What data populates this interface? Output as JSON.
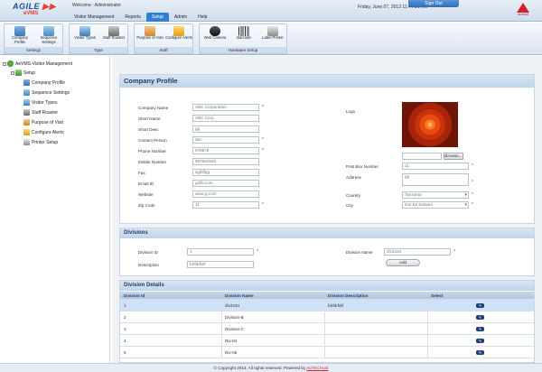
{
  "header": {
    "logo_main": "AGILE",
    "logo_sub": "eVMS",
    "welcome": "Welcome :  Administrator",
    "datetime": "Friday, June 07, 2013   11:44:31 AM",
    "signout": "Sign Out",
    "brand": "ALTECH",
    "tabs": [
      {
        "label": "Visitor Management",
        "active": false
      },
      {
        "label": "Reports",
        "active": false
      },
      {
        "label": "Setup",
        "active": true
      },
      {
        "label": "Admin",
        "active": false
      },
      {
        "label": "Help",
        "active": false
      }
    ]
  },
  "ribbon": {
    "groups": [
      {
        "title": "Settings",
        "buttons": [
          "Company Profile",
          "Sequence Settings"
        ]
      },
      {
        "title": "Type",
        "buttons": [
          "Visitor Types",
          "Staff Roaster"
        ]
      },
      {
        "title": "Staff",
        "buttons": [
          "Purpose of Visit",
          "Configure Alerts"
        ]
      },
      {
        "title": "Hardware Setup",
        "buttons": [
          "Web Camera",
          "Barcode",
          "Label Printer"
        ]
      }
    ]
  },
  "tree": {
    "root": "AeVMS-Visitor Management",
    "setup": "Setup",
    "items": [
      "Company Profile",
      "Sequence Settings",
      "Visitor Types",
      "Staff Roaster",
      "Purpose of Visit",
      "Configure Alerts",
      "Printer Setup"
    ]
  },
  "company_profile": {
    "title": "Company Profile",
    "fields": [
      {
        "label": "Company Name",
        "value": "ABC Corporation",
        "required": true
      },
      {
        "label": "Short Name",
        "value": "ABC Corp",
        "required": false
      },
      {
        "label": "Short Desc",
        "value": "gg",
        "required": false
      },
      {
        "label": "Contact Person",
        "value": "abc",
        "required": true
      },
      {
        "label": "Phone Number",
        "value": "878978",
        "required": true
      },
      {
        "label": "Mobile Number",
        "value": "987654545",
        "required": false
      },
      {
        "label": "Fax",
        "value": "sgjhffgg",
        "required": false
      },
      {
        "label": "Email ID",
        "value": "g@b.com",
        "required": false
      },
      {
        "label": "Website",
        "value": "www.g.com",
        "required": false
      },
      {
        "label": "Zip Code",
        "value": "11",
        "required": true
      }
    ],
    "logo_label": "Logo",
    "browse_label": "Browse...",
    "right_fields": [
      {
        "label": "Post Box Number",
        "value": "11",
        "required": true
      },
      {
        "label": "Address",
        "value": "gg",
        "required": true
      },
      {
        "label": "Country",
        "value": "Tanzania",
        "required": true
      },
      {
        "label": "City",
        "value": "Dar Es Salaam",
        "required": true
      }
    ]
  },
  "divisions": {
    "title": "Divisions",
    "id_label": "Division ID",
    "id_value": "1",
    "desc_label": "Description",
    "desc_value": "fdrfdrfdrf",
    "name_label": "Division Name",
    "name_value": "div3434",
    "add_label": "Add"
  },
  "division_details": {
    "title": "Division Details",
    "columns": [
      "Division Id",
      "Division Name",
      "Division Description",
      "Select"
    ],
    "rows": [
      {
        "id": "1",
        "name": "div3434",
        "desc": "fdrfdrfdrf"
      },
      {
        "id": "2",
        "name": "Division-B",
        "desc": ""
      },
      {
        "id": "3",
        "name": "Division-C",
        "desc": ""
      },
      {
        "id": "4",
        "name": "Div-04",
        "desc": ""
      },
      {
        "id": "5",
        "name": "Div-05",
        "desc": ""
      }
    ]
  },
  "footer": {
    "text": "© Copyright 2013. All rights reserved. Powered by",
    "link": "ALTECHunt"
  }
}
